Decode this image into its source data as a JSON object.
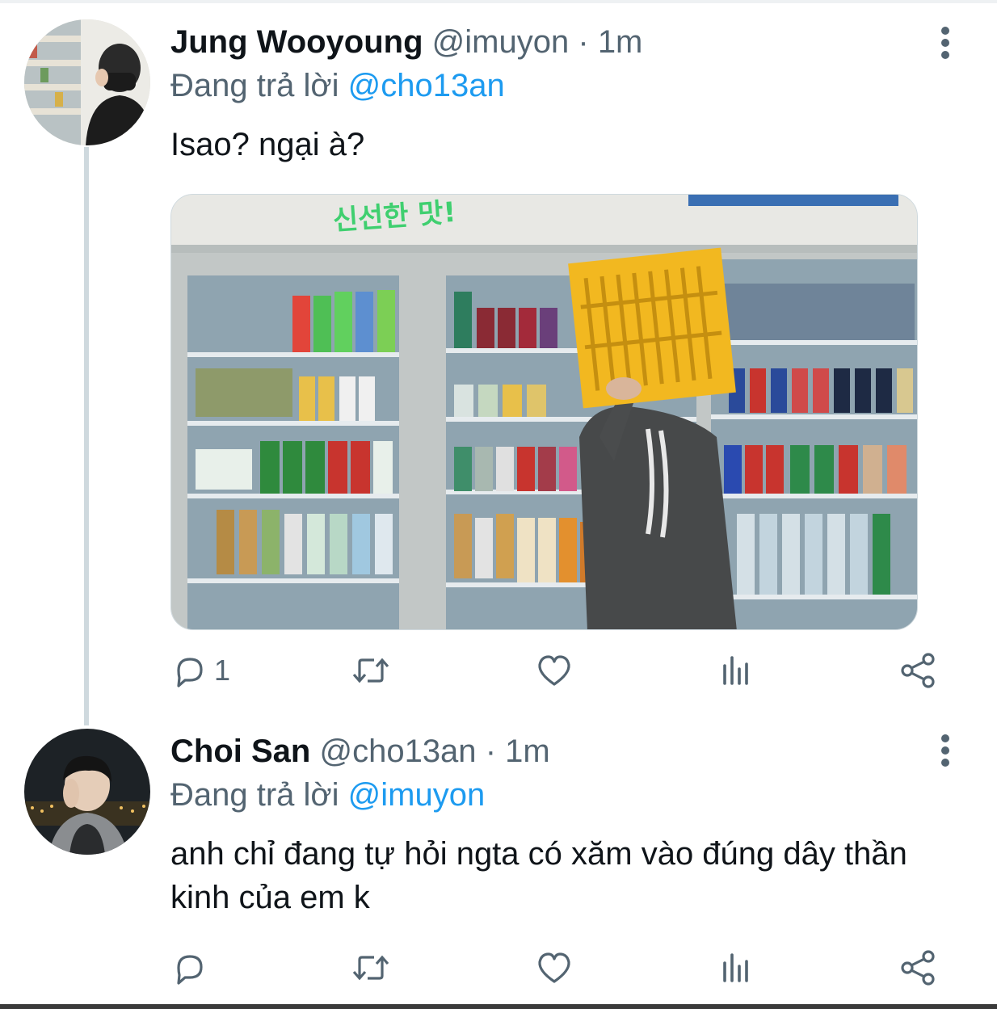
{
  "colors": {
    "text_primary": "#0f1419",
    "text_secondary": "#536471",
    "accent": "#1d9bf0",
    "thread_line": "#cfd9de"
  },
  "tweets": [
    {
      "display_name": "Jung Wooyoung",
      "handle": "@imuyon",
      "separator": "·",
      "time": "1m",
      "reply_prefix": "Đang trả lời",
      "reply_mention": "@cho13an",
      "text": "Isao? ngại à?",
      "media": {
        "sign_text": "신선한 맛!"
      },
      "actions": {
        "reply_icon": "reply-icon",
        "reply_count": "1",
        "retweet_icon": "retweet-icon",
        "like_icon": "heart-icon",
        "views_icon": "bar-chart-icon",
        "share_icon": "share-icon"
      },
      "more_icon": "more-vertical-icon"
    },
    {
      "display_name": "Choi San",
      "handle": "@cho13an",
      "separator": "·",
      "time": "1m",
      "reply_prefix": "Đang trả lời",
      "reply_mention": "@imuyon",
      "text": "anh chỉ đang tự hỏi ngta có xăm vào đúng dây thần kinh của em k",
      "actions": {
        "reply_icon": "reply-icon",
        "reply_count": "",
        "retweet_icon": "retweet-icon",
        "like_icon": "heart-icon",
        "views_icon": "bar-chart-icon",
        "share_icon": "share-icon"
      },
      "more_icon": "more-vertical-icon"
    }
  ]
}
